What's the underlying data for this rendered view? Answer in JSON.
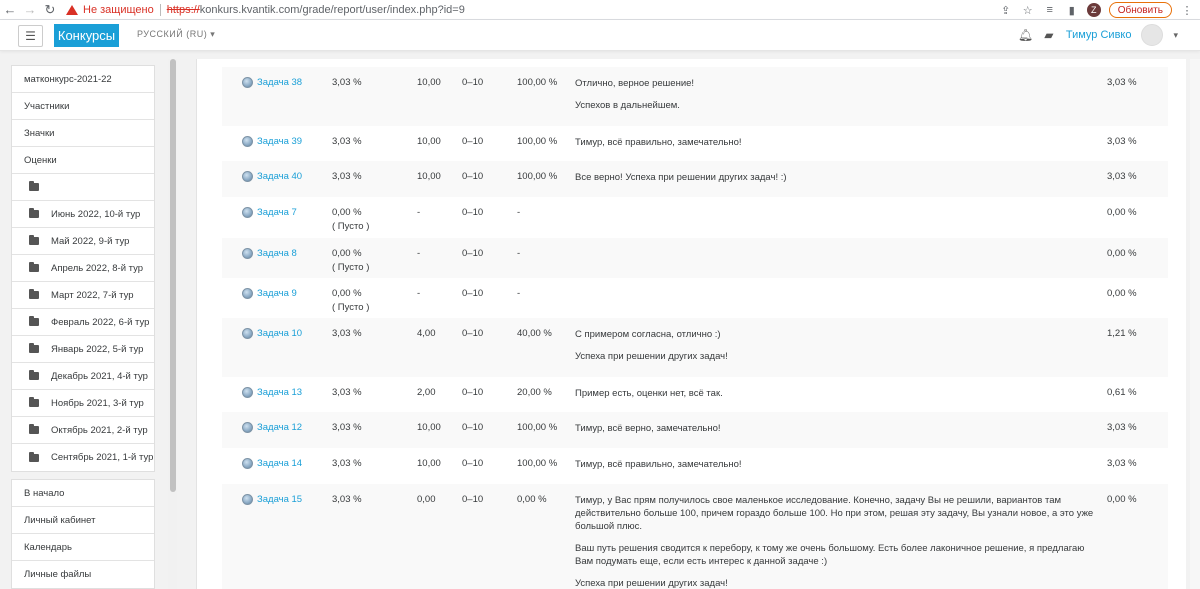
{
  "browser": {
    "warning": "Не защищено",
    "url_scheme": "https://",
    "url_rest": "konkurs.kvantik.com/grade/report/user/index.php?id=9",
    "profile_letter": "Z",
    "update_label": "Обновить"
  },
  "navbar": {
    "brand": "Конкурсы",
    "language": "РУССКИЙ (RU)",
    "user_name": "Тимур Сивко"
  },
  "sidebar": {
    "group1": [
      {
        "label": "матконкурс-2021-22"
      },
      {
        "label": "Участники"
      },
      {
        "label": "Значки"
      },
      {
        "label": "Оценки"
      },
      {
        "label": ""
      },
      {
        "label": "Июнь 2022, 10-й тур"
      },
      {
        "label": "Май 2022, 9-й тур"
      },
      {
        "label": "Апрель 2022, 8-й тур"
      },
      {
        "label": "Март 2022, 7-й тур"
      },
      {
        "label": "Февраль 2022, 6-й тур"
      },
      {
        "label": "Январь 2022, 5-й тур"
      },
      {
        "label": "Декабрь 2021, 4-й тур"
      },
      {
        "label": "Ноябрь 2021, 3-й тур"
      },
      {
        "label": "Октябрь 2021, 2-й тур"
      },
      {
        "label": "Сентябрь 2021, 1-й тур"
      }
    ],
    "group2": [
      {
        "label": "В начало"
      },
      {
        "label": "Личный кабинет"
      },
      {
        "label": "Календарь"
      },
      {
        "label": "Личные файлы"
      }
    ]
  },
  "grades": {
    "empty_label": "( Пусто )",
    "rows": [
      {
        "item": "Задача 38",
        "weight": "3,03 %",
        "grade": "10,00",
        "range": "0–10",
        "percent": "100,00 %",
        "feedback": [
          "Отлично, верное решение!",
          "Успехов в дальнейшем."
        ],
        "contribution": "3,03 %"
      },
      {
        "item": "Задача 39",
        "weight": "3,03 %",
        "grade": "10,00",
        "range": "0–10",
        "percent": "100,00 %",
        "feedback": [
          "Тимур, всё правильно, замечательно!"
        ],
        "contribution": "3,03 %"
      },
      {
        "item": "Задача 40",
        "weight": "3,03 %",
        "grade": "10,00",
        "range": "0–10",
        "percent": "100,00 %",
        "feedback": [
          "Все верно! Успеха при решении других задач! :)"
        ],
        "contribution": "3,03 %"
      },
      {
        "item": "Задача 7",
        "weight": "0,00 %",
        "grade": "-",
        "range": "0–10",
        "percent": "-",
        "feedback": [],
        "contribution": "0,00 %"
      },
      {
        "item": "Задача 8",
        "weight": "0,00 %",
        "grade": "-",
        "range": "0–10",
        "percent": "-",
        "feedback": [],
        "contribution": "0,00 %"
      },
      {
        "item": "Задача 9",
        "weight": "0,00 %",
        "grade": "-",
        "range": "0–10",
        "percent": "-",
        "feedback": [],
        "contribution": "0,00 %"
      },
      {
        "item": "Задача 10",
        "weight": "3,03 %",
        "grade": "4,00",
        "range": "0–10",
        "percent": "40,00 %",
        "feedback": [
          "С примером согласна, отлично :)",
          "Успеха при решении других задач!"
        ],
        "contribution": "1,21 %"
      },
      {
        "item": "Задача 13",
        "weight": "3,03 %",
        "grade": "2,00",
        "range": "0–10",
        "percent": "20,00 %",
        "feedback": [
          "Пример есть, оценки нет, всё так."
        ],
        "contribution": "0,61 %"
      },
      {
        "item": "Задача 12",
        "weight": "3,03 %",
        "grade": "10,00",
        "range": "0–10",
        "percent": "100,00 %",
        "feedback": [
          "Тимур, всё верно, замечательно!"
        ],
        "contribution": "3,03 %"
      },
      {
        "item": "Задача 14",
        "weight": "3,03 %",
        "grade": "10,00",
        "range": "0–10",
        "percent": "100,00 %",
        "feedback": [
          "Тимур, всё правильно, замечательно!"
        ],
        "contribution": "3,03 %"
      },
      {
        "item": "Задача 15",
        "weight": "3,03 %",
        "grade": "0,00",
        "range": "0–10",
        "percent": "0,00 %",
        "feedback": [
          "Тимур, у Вас прям получилось свое маленькое исследование. Конечно, задачу Вы не решили, вариантов там действительно больше 100, причем гораздо больше 100. Но при этом, решая эту задачу, Вы узнали новое, а это уже большой плюс.",
          "Ваш путь решения сводится к перебору, к тому же очень большому. Есть более лаконичное решение, я предлагаю Вам подумать еще, если есть интерес к данной задаче :)",
          "Успеха при решении других задач!"
        ],
        "contribution": "0,00 %"
      }
    ]
  }
}
